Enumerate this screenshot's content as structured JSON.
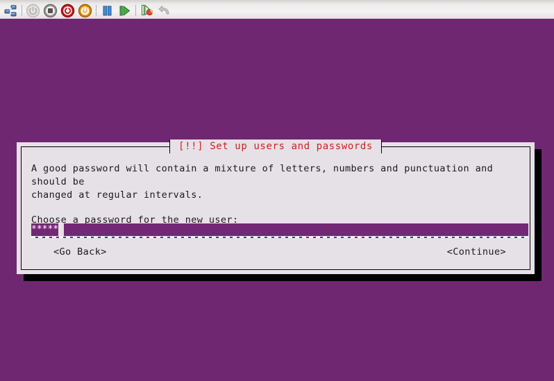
{
  "toolbar": {
    "items": [
      {
        "name": "vm-network-icon",
        "tip": "Virtual machine network"
      },
      {
        "name": "separator-1"
      },
      {
        "name": "power-on-icon",
        "tip": "Power On"
      },
      {
        "name": "shutdown-icon",
        "tip": "Shut Down Guest"
      },
      {
        "name": "power-off-icon",
        "tip": "Power Off"
      },
      {
        "name": "suspend-icon",
        "tip": "Suspend"
      },
      {
        "name": "separator-2"
      },
      {
        "name": "pause-icon",
        "tip": "Pause"
      },
      {
        "name": "resume-icon",
        "tip": "Resume"
      },
      {
        "name": "separator-3"
      },
      {
        "name": "snapshot-icon",
        "tip": "Take Snapshot"
      },
      {
        "name": "revert-icon",
        "tip": "Revert"
      }
    ]
  },
  "dialog": {
    "title": "[!!] Set up users and passwords",
    "body_text": "A good password will contain a mixture of letters, numbers and punctuation and should be\nchanged at regular intervals.",
    "prompt": "Choose a password for the new user:",
    "password": {
      "masked_value": "*****",
      "mask_char": "*",
      "char_count": 5,
      "value_hidden": true
    },
    "buttons": {
      "back": "<Go Back>",
      "continue": "<Continue>"
    }
  },
  "colors": {
    "desktop_background": "#702771",
    "dialog_background": "#e6e1e6",
    "dialog_border": "#000000",
    "title_text": "#cc2222",
    "body_text": "#1a1a1a",
    "field_background": "#722874",
    "field_text": "#ffffff",
    "shadow": "#000000",
    "toolbar_background": "#ecebeb"
  }
}
